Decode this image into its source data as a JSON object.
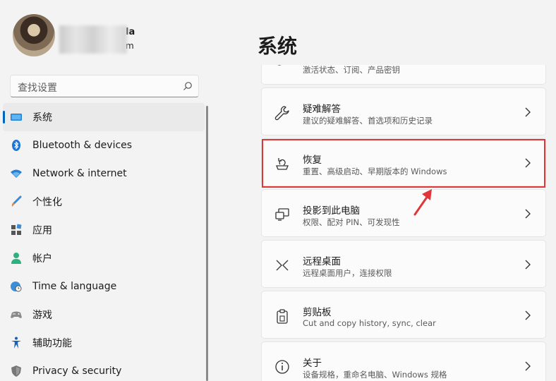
{
  "profile": {
    "name_suffix": "la",
    "email_suffix": "m"
  },
  "search": {
    "placeholder": "查找设置"
  },
  "nav": {
    "items": [
      {
        "label": "系统",
        "icon": "monitor-icon"
      },
      {
        "label": "Bluetooth & devices",
        "icon": "bluetooth-icon"
      },
      {
        "label": "Network & internet",
        "icon": "wifi-icon"
      },
      {
        "label": "个性化",
        "icon": "brush-icon"
      },
      {
        "label": "应用",
        "icon": "apps-icon"
      },
      {
        "label": "帐户",
        "icon": "person-icon"
      },
      {
        "label": "Time & language",
        "icon": "globe-clock-icon"
      },
      {
        "label": "游戏",
        "icon": "gamepad-icon"
      },
      {
        "label": "辅助功能",
        "icon": "accessibility-icon"
      },
      {
        "label": "Privacy & security",
        "icon": "shield-icon"
      }
    ]
  },
  "main": {
    "title": "系统",
    "cards": [
      {
        "title": "",
        "subtitle": "激活状态、订阅、产品密钥",
        "icon": "key-icon"
      },
      {
        "title": "疑难解答",
        "subtitle": "建议的疑难解答、首选项和历史记录",
        "icon": "wrench-icon"
      },
      {
        "title": "恢复",
        "subtitle": "重置、高级启动、早期版本的 Windows",
        "icon": "recovery-icon"
      },
      {
        "title": "投影到此电脑",
        "subtitle": "权限、配对 PIN、可发现性",
        "icon": "project-icon"
      },
      {
        "title": "远程桌面",
        "subtitle": "远程桌面用户，连接权限",
        "icon": "remote-desktop-icon"
      },
      {
        "title": "剪贴板",
        "subtitle": "Cut and copy history, sync, clear",
        "icon": "clipboard-icon"
      },
      {
        "title": "关于",
        "subtitle": "设备规格，重命名电脑、Windows 规格",
        "icon": "info-icon"
      }
    ]
  },
  "colors": {
    "accent": "#0067c0",
    "highlight": "#e0363a"
  }
}
